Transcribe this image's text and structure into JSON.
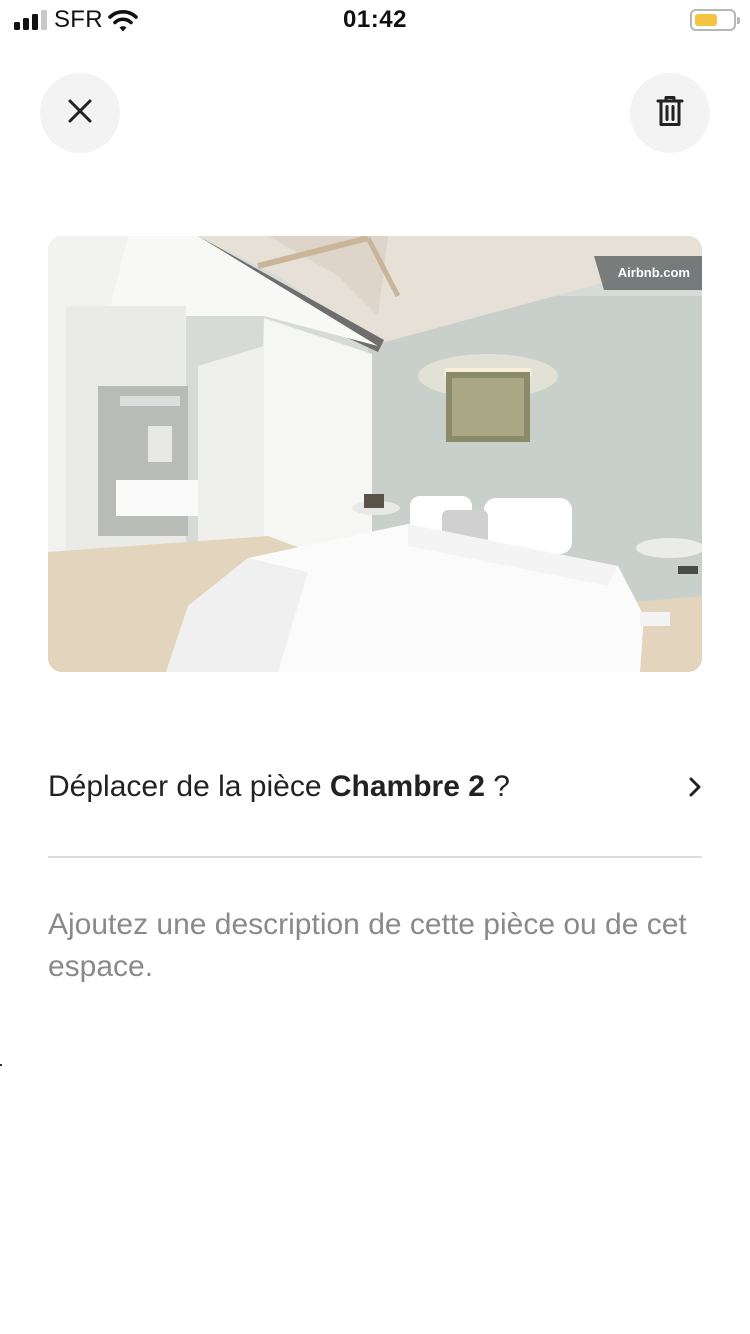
{
  "status_bar": {
    "carrier": "SFR",
    "time": "01:42",
    "battery_color": "#f5c242"
  },
  "toolbar": {
    "close_icon": "close-icon",
    "delete_icon": "trash-icon"
  },
  "photo": {
    "watermark": "Airbnb.com"
  },
  "move_row": {
    "prefix": "Déplacer de la pièce ",
    "room": "Chambre 2",
    "suffix": " ?"
  },
  "description": {
    "placeholder": "Ajoutez une description de cette pièce ou de cet espace."
  }
}
